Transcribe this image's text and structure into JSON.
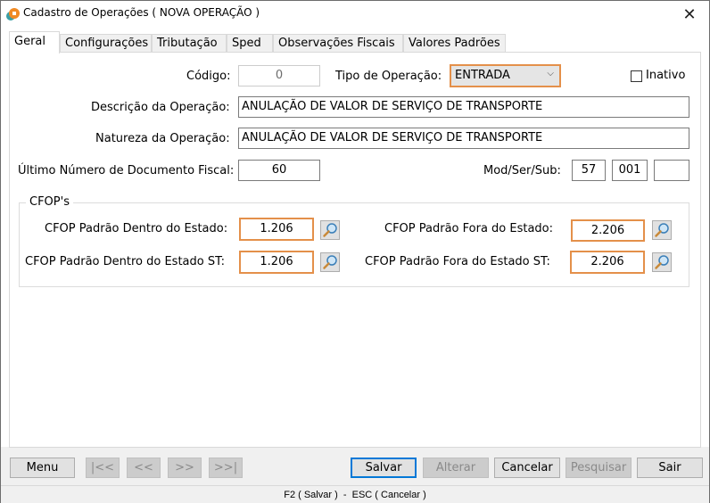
{
  "window": {
    "title": "Cadastro de Operações ( NOVA OPERAÇÃO )",
    "app_icon": "app-logo-icon",
    "close_glyph": "✕"
  },
  "tabs": [
    {
      "label": "Geral",
      "active": true
    },
    {
      "label": "Configurações",
      "active": false
    },
    {
      "label": "Tributação",
      "active": false
    },
    {
      "label": "Sped",
      "active": false
    },
    {
      "label": "Observações Fiscais",
      "active": false
    },
    {
      "label": "Valores Padrões",
      "active": false
    }
  ],
  "form": {
    "codigo": {
      "label": "Código:",
      "value": "0"
    },
    "tipo_operacao": {
      "label": "Tipo de Operação:",
      "value": "ENTRADA"
    },
    "inativo": {
      "label": "Inativo",
      "checked": false
    },
    "descricao": {
      "label": "Descrição da Operação:",
      "value": "ANULAÇÃO DE VALOR DE SERVIÇO DE TRANSPORTE"
    },
    "natureza": {
      "label": "Natureza da Operação:",
      "value": "ANULAÇÃO DE VALOR DE SERVIÇO DE TRANSPORTE"
    },
    "ultimo_numero": {
      "label": "Último Número de Documento Fiscal:",
      "value": "60"
    },
    "mod_ser_sub": {
      "label": "Mod/Ser/Sub:",
      "mod": "57",
      "ser": "001",
      "sub": ""
    }
  },
  "cfop_group": {
    "title": "CFOP's",
    "dentro_estado": {
      "label": "CFOP Padrão Dentro do Estado:",
      "value": "1.206"
    },
    "fora_estado": {
      "label": "CFOP Padrão Fora do Estado:",
      "value": "2.206"
    },
    "dentro_estado_st": {
      "label": "CFOP Padrão Dentro do Estado ST:",
      "value": "1.206"
    },
    "fora_estado_st": {
      "label": "CFOP Padrão Fora do Estado ST:",
      "value": "2.206"
    }
  },
  "buttons": {
    "menu": "Menu",
    "first": "|<<",
    "prev": "<<",
    "next": ">>",
    "last": ">>|",
    "salvar": "Salvar",
    "alterar": "Alterar",
    "cancelar": "Cancelar",
    "pesquisar": "Pesquisar",
    "sair": "Sair"
  },
  "statusbar": {
    "text": "F2 ( Salvar )  -  ESC ( Cancelar )"
  },
  "colors": {
    "focus_border": "#e4904a",
    "default_button_border": "#0078d7"
  }
}
